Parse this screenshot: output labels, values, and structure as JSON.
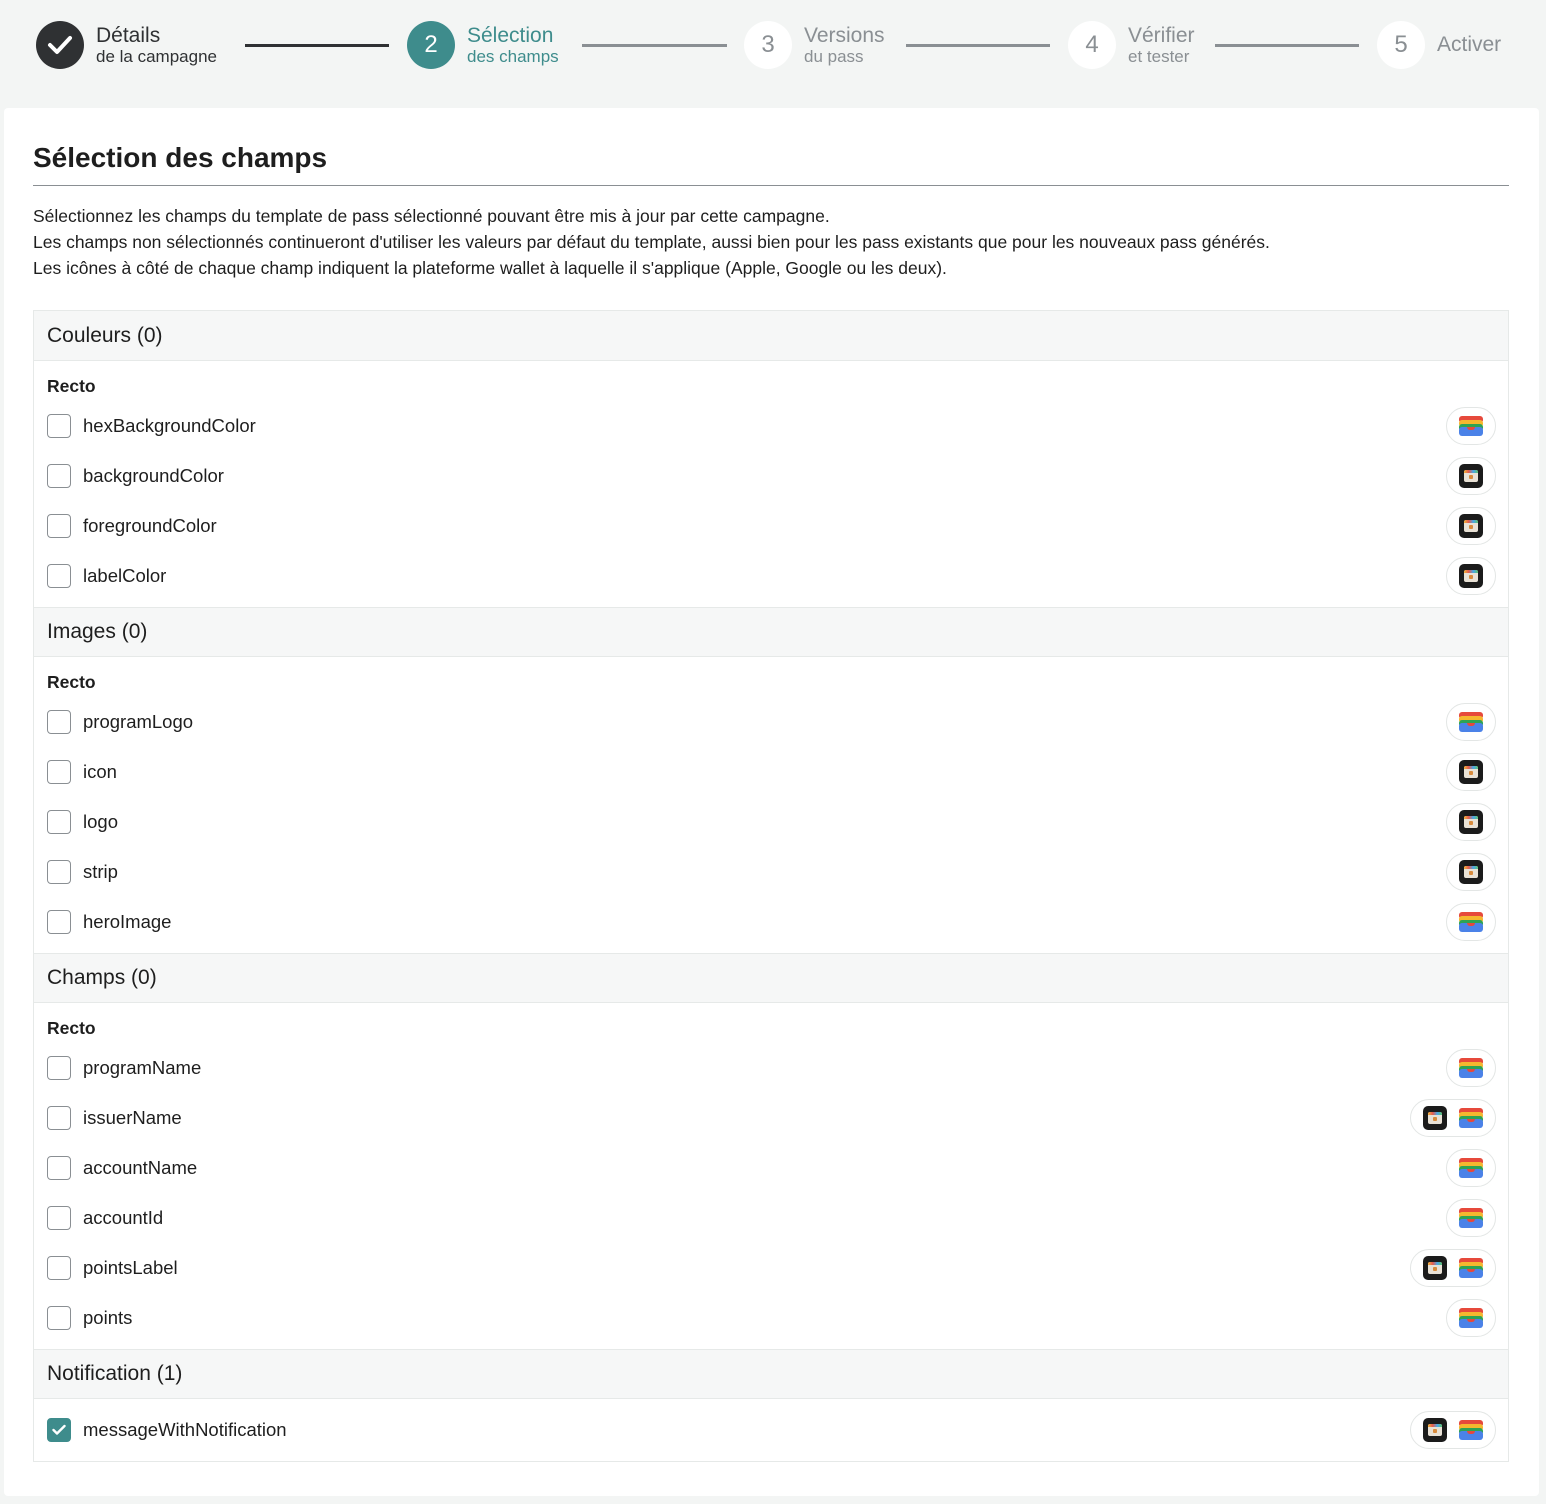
{
  "colors": {
    "accent": "#3e8c8c",
    "dark": "#2f3133",
    "muted": "#8a8f93"
  },
  "stepper": {
    "steps": [
      {
        "number": "",
        "title": "Détails",
        "subtitle": "de la campagne",
        "state": "done",
        "icon": "check-icon"
      },
      {
        "number": "2",
        "title": "Sélection",
        "subtitle": "des champs",
        "state": "active"
      },
      {
        "number": "3",
        "title": "Versions",
        "subtitle": "du pass",
        "state": "todo"
      },
      {
        "number": "4",
        "title": "Vérifier",
        "subtitle": "et tester",
        "state": "todo"
      },
      {
        "number": "5",
        "title": "Activer",
        "subtitle": "",
        "state": "todo"
      }
    ]
  },
  "page": {
    "title": "Sélection des champs",
    "description": [
      "Sélectionnez les champs du template de pass sélectionné pouvant être mis à jour par cette campagne.",
      "Les champs non sélectionnés continueront d'utiliser les valeurs par défaut du template, aussi bien pour les pass existants que pour les nouveaux pass générés.",
      "Les icônes à côté de chaque champ indiquent la plateforme wallet à laquelle il s'applique (Apple, Google ou les deux)."
    ]
  },
  "sections": [
    {
      "title": "Couleurs (0)",
      "subhead": "Recto",
      "fields": [
        {
          "name": "hexBackgroundColor",
          "checked": false,
          "platforms": [
            "google"
          ]
        },
        {
          "name": "backgroundColor",
          "checked": false,
          "platforms": [
            "apple"
          ]
        },
        {
          "name": "foregroundColor",
          "checked": false,
          "platforms": [
            "apple"
          ]
        },
        {
          "name": "labelColor",
          "checked": false,
          "platforms": [
            "apple"
          ]
        }
      ]
    },
    {
      "title": "Images (0)",
      "subhead": "Recto",
      "fields": [
        {
          "name": "programLogo",
          "checked": false,
          "platforms": [
            "google"
          ]
        },
        {
          "name": "icon",
          "checked": false,
          "platforms": [
            "apple"
          ]
        },
        {
          "name": "logo",
          "checked": false,
          "platforms": [
            "apple"
          ]
        },
        {
          "name": "strip",
          "checked": false,
          "platforms": [
            "apple"
          ]
        },
        {
          "name": "heroImage",
          "checked": false,
          "platforms": [
            "google"
          ]
        }
      ]
    },
    {
      "title": "Champs (0)",
      "subhead": "Recto",
      "fields": [
        {
          "name": "programName",
          "checked": false,
          "platforms": [
            "google"
          ]
        },
        {
          "name": "issuerName",
          "checked": false,
          "platforms": [
            "apple",
            "google"
          ]
        },
        {
          "name": "accountName",
          "checked": false,
          "platforms": [
            "google"
          ]
        },
        {
          "name": "accountId",
          "checked": false,
          "platforms": [
            "google"
          ]
        },
        {
          "name": "pointsLabel",
          "checked": false,
          "platforms": [
            "apple",
            "google"
          ]
        },
        {
          "name": "points",
          "checked": false,
          "platforms": [
            "google"
          ]
        }
      ]
    },
    {
      "title": "Notification (1)",
      "subhead": "",
      "fields": [
        {
          "name": "messageWithNotification",
          "checked": true,
          "platforms": [
            "apple",
            "google"
          ]
        }
      ]
    }
  ]
}
